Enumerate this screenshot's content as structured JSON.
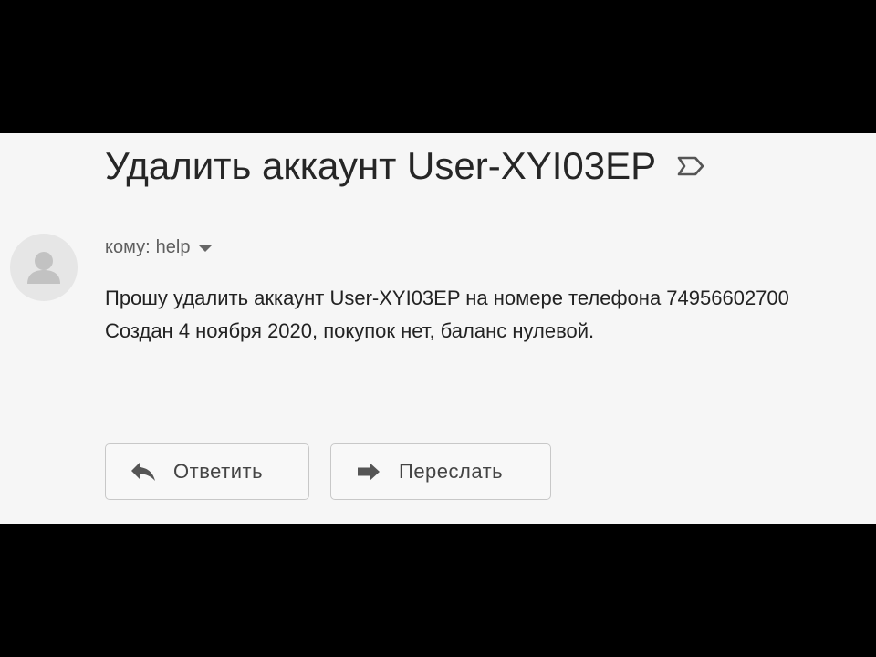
{
  "email": {
    "subject": "Удалить аккаунт User-XYI03EP",
    "recipient_prefix": "кому:",
    "recipient_name": "help",
    "body_lines": [
      "Прошу удалить аккаунт User-XYI03EP на номере телефона 74956602700",
      "Создан 4 ноября 2020, покупок нет, баланс нулевой."
    ]
  },
  "actions": {
    "reply_label": "Ответить",
    "forward_label": "Переслать"
  },
  "icons": {
    "label": "label-outline-icon",
    "avatar": "default-person-icon",
    "recipient_dropdown": "caret-down-icon",
    "reply": "reply-arrow-icon",
    "forward": "forward-arrow-icon"
  },
  "colors": {
    "panel_background": "#f6f6f6",
    "letterbox": "#000000",
    "text_primary": "#222222",
    "text_secondary": "#5f5f5f"
  }
}
